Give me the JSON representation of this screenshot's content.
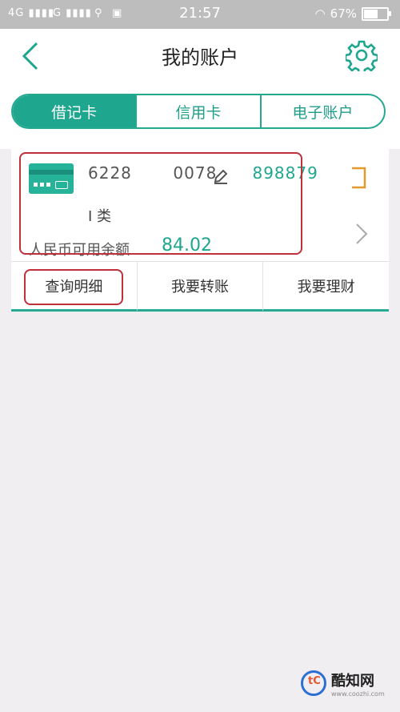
{
  "status_bar": {
    "signal_left": "4G",
    "signal_right": "G",
    "time": "21:57",
    "battery": "67%",
    "battery_level": 0.67
  },
  "header": {
    "title": "我的账户",
    "back_icon": "chevron-left-icon",
    "settings_icon": "gear-icon"
  },
  "tabs": [
    {
      "label": "借记卡",
      "active": true
    },
    {
      "label": "信用卡",
      "active": false
    },
    {
      "label": "电子账户",
      "active": false
    }
  ],
  "card": {
    "number_part1": "6228",
    "number_part2": "0078",
    "number_part3": "898879",
    "holder": "I 类",
    "balance_label": "人民币可用余额",
    "balance_value": "84.02"
  },
  "actions": [
    {
      "label": "查询明细"
    },
    {
      "label": "我要转账"
    },
    {
      "label": "我要理财"
    }
  ],
  "watermark": {
    "name": "酷知网",
    "url": "www.coozhi.com"
  },
  "colors": {
    "accent": "#1fa68e",
    "highlight": "#c0303a",
    "background": "#f1eef2"
  }
}
